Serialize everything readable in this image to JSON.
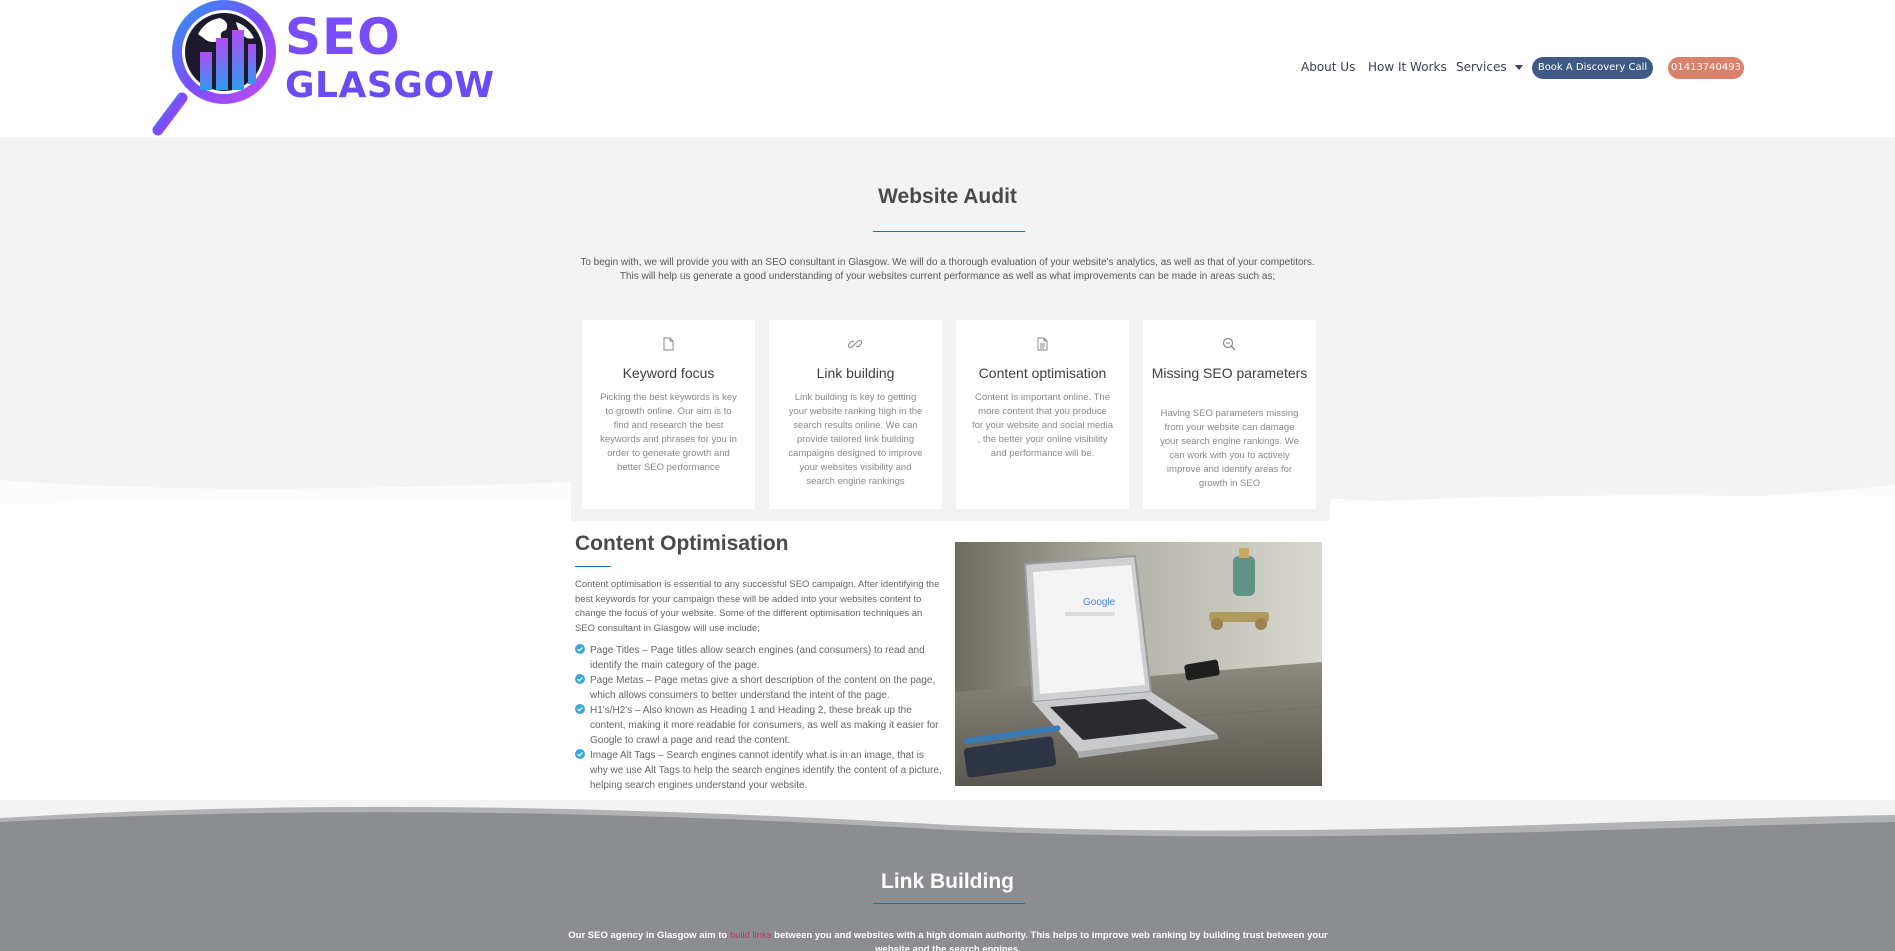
{
  "brand": {
    "line1": "SEO",
    "line2": "GLASGOW",
    "colors": {
      "primary": "#7a4dfc",
      "secondary": "#2d9bf0",
      "dark": "#1e1a2e"
    }
  },
  "nav": {
    "about": "About Us",
    "how": "How It Works",
    "services": "Services",
    "discovery": "Book A Discovery Call",
    "phone": "01413740493"
  },
  "audit": {
    "title": "Website Audit",
    "intro": "To begin with, we will provide you with an SEO consultant in Glasgow. We will do a thorough evaluation of your website's analytics, as well as that of your competitors. This will help us generate a good understanding of your websites current performance as well as what improvements can be made in areas such as;",
    "cards": [
      {
        "icon": "file-icon",
        "title": "Keyword focus",
        "text": "Picking the best keywords is key to growth online. Our aim is to find and research the best keywords and phrases for you in order to generate growth and better SEO performance"
      },
      {
        "icon": "link-icon",
        "title": "Link building",
        "text": "Link building is key to getting your website ranking high in the search results online. We can provide tailored link building campaigns designed to improve your websites visibility and search engine rankings"
      },
      {
        "icon": "document-text-icon",
        "title": "Content optimisation",
        "text": "Content Is important online. The more content that you produce for your website and social media , the better your online visibility and performance will be."
      },
      {
        "icon": "search-minus-icon",
        "title": "Missing SEO parameters",
        "text": "Having SEO parameters missing from your website can damage your search engine rankings. We can work with you to actively improve and identify areas for growth in SEO"
      }
    ]
  },
  "content_opt": {
    "title": "Content Optimisation",
    "intro": "Content optimisation is essential to any successful SEO campaign. After identifying the best keywords for your campaign these will be added into your websites content to change the focus of your website. Some of the different optimisation techniques an SEO consultant in Glasgow will use include;",
    "items": [
      "Page Titles – Page titles allow search engines (and consumers) to read and identify the main category of the page.",
      "Page Metas – Page metas give a short description of the content on the page, which allows consumers to better understand the intent of the page.",
      "H1's/H2's – Also known as Heading 1 and Heading 2, these break up the content, making it more readable for consumers, as well as making it easier for Google to crawl a page and read the content.",
      "Image Alt Tags – Search engines cannot identify what is in an image, that is why we use Alt Tags to help the search engines identify the content of a picture, helping search engines understand your website."
    ],
    "image_search_text": "Google"
  },
  "link_building": {
    "title": "Link Building",
    "text_before": "Our SEO agency in Glasgow aim to ",
    "link_text": "build links",
    "text_after": " between you and websites with a high domain authority. This helps to improve web ranking by building trust between your website and the search engines."
  }
}
